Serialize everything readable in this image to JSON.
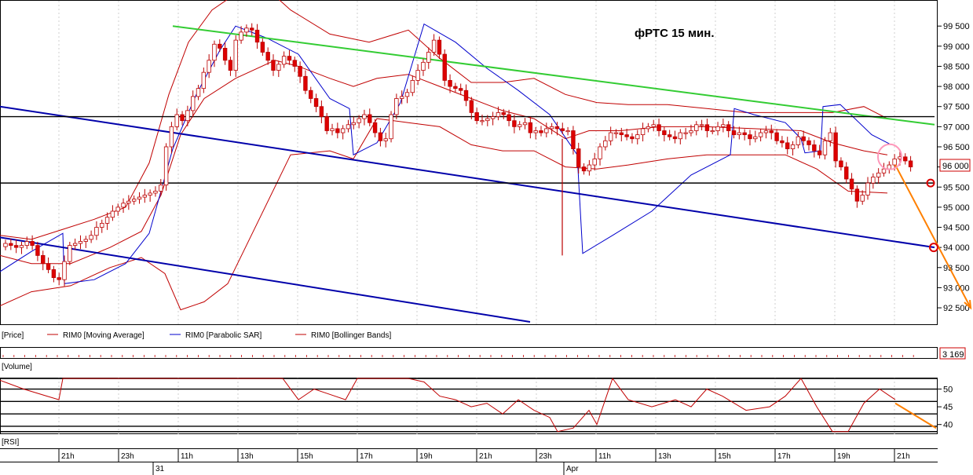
{
  "chart_data": {
    "type": "candlestick",
    "title": "фРТС   15 мин.",
    "price_axis": {
      "ticks": [
        "99 500",
        "99 000",
        "98 500",
        "98 000",
        "97 500",
        "97 000",
        "96 500",
        "96 000",
        "95 500",
        "95 000",
        "94 500",
        "94 000",
        "93 500",
        "93 000",
        "92 500"
      ],
      "range": [
        92150,
        100050
      ],
      "last_price_label": "96 000",
      "last_price": 96000
    },
    "time_axis": {
      "hour_labels": [
        "21h",
        "23h",
        "11h",
        "13h",
        "15h",
        "17h",
        "19h",
        "21h",
        "23h",
        "11h",
        "13h",
        "15h",
        "17h",
        "19h",
        "21h"
      ],
      "day_labels": [
        "31",
        "Apr"
      ]
    },
    "legend": [
      {
        "label": "[Price]",
        "color": "#000000"
      },
      {
        "label": "RIM0 [Moving Average]",
        "color": "#c00000"
      },
      {
        "label": "RIM0 [Parabolic SAR]",
        "color": "#0000cc"
      },
      {
        "label": "RIM0 [Bollinger Bands]",
        "color": "#c00000"
      }
    ],
    "volume_panel": {
      "label": "[Volume]",
      "last_value_label": "3 169"
    },
    "rsi_panel": {
      "label": "[RSI]",
      "ticks": [
        "50",
        "45",
        "40"
      ],
      "range": [
        37.5,
        53
      ],
      "levels": [
        53,
        50,
        46.5,
        43,
        39.5,
        38
      ]
    },
    "closes": [
      94100,
      94050,
      94000,
      94050,
      94150,
      94050,
      93800,
      93600,
      93450,
      93250,
      93200,
      93650,
      94050,
      94100,
      94150,
      94200,
      94300,
      94500,
      94600,
      94750,
      94900,
      95000,
      95100,
      95150,
      95200,
      95250,
      95300,
      95350,
      95400,
      95550,
      96500,
      97000,
      97300,
      97150,
      97400,
      97750,
      97950,
      98350,
      98650,
      99050,
      98950,
      98650,
      98400,
      99150,
      99350,
      99450,
      99400,
      99100,
      98850,
      98650,
      98400,
      98550,
      98750,
      98650,
      98500,
      98250,
      97900,
      97700,
      97500,
      97250,
      96900,
      96950,
      96850,
      96950,
      97050,
      97100,
      97200,
      97300,
      97100,
      96850,
      96650,
      96700,
      97300,
      97700,
      97750,
      97850,
      98150,
      98400,
      98600,
      98850,
      99150,
      98800,
      98150,
      98000,
      97950,
      97900,
      97650,
      97350,
      97150,
      97150,
      97200,
      97250,
      97350,
      97300,
      97150,
      97000,
      97050,
      97100,
      96850,
      96900,
      96850,
      96950,
      97000,
      96950,
      96900,
      96900,
      96450,
      96000,
      95900,
      96050,
      96200,
      96500,
      96650,
      96850,
      96850,
      96800,
      96750,
      96700,
      96800,
      96950,
      97000,
      97050,
      96900,
      96800,
      96750,
      96700,
      96850,
      96850,
      96900,
      97050,
      97050,
      96900,
      96900,
      97000,
      97050,
      96900,
      96800,
      96850,
      96800,
      96700,
      96750,
      96850,
      96900,
      96850,
      96650,
      96600,
      96450,
      96550,
      96750,
      96650,
      96550,
      96400,
      96300,
      96650,
      96850,
      96150,
      96000,
      95700,
      95450,
      95150,
      95300,
      95600,
      95750,
      95850,
      95950,
      96050,
      96200,
      96250,
      96150,
      96000
    ],
    "moving_average": [
      [
        0,
        93800
      ],
      [
        40,
        93600
      ],
      [
        90,
        93600
      ],
      [
        140,
        94000
      ],
      [
        180,
        94400
      ],
      [
        205,
        95300
      ],
      [
        230,
        96800
      ],
      [
        260,
        97700
      ],
      [
        300,
        98200
      ],
      [
        350,
        98650
      ],
      [
        380,
        98500
      ],
      [
        420,
        98200
      ],
      [
        450,
        98000
      ],
      [
        480,
        98200
      ],
      [
        520,
        98300
      ],
      [
        560,
        98000
      ],
      [
        600,
        97700
      ],
      [
        640,
        97400
      ],
      [
        680,
        97200
      ],
      [
        720,
        96700
      ],
      [
        750,
        96900
      ],
      [
        790,
        96900
      ],
      [
        840,
        97000
      ],
      [
        900,
        97000
      ],
      [
        960,
        96950
      ],
      [
        1020,
        96900
      ],
      [
        1060,
        96600
      ],
      [
        1100,
        96400
      ],
      [
        1130,
        96300
      ]
    ],
    "bollinger_upper": [
      [
        0,
        94300
      ],
      [
        40,
        94200
      ],
      [
        80,
        94450
      ],
      [
        120,
        94700
      ],
      [
        160,
        95000
      ],
      [
        190,
        96100
      ],
      [
        215,
        97800
      ],
      [
        240,
        99100
      ],
      [
        270,
        99900
      ],
      [
        300,
        100300
      ],
      [
        330,
        100600
      ],
      [
        370,
        99900
      ],
      [
        420,
        99300
      ],
      [
        470,
        99100
      ],
      [
        520,
        99400
      ],
      [
        560,
        98700
      ],
      [
        600,
        98100
      ],
      [
        640,
        98100
      ],
      [
        680,
        98200
      ],
      [
        720,
        97800
      ],
      [
        760,
        97600
      ],
      [
        800,
        97550
      ],
      [
        850,
        97550
      ],
      [
        900,
        97450
      ],
      [
        950,
        97350
      ],
      [
        1000,
        97350
      ],
      [
        1060,
        97350
      ],
      [
        1100,
        97500
      ],
      [
        1130,
        97200
      ]
    ],
    "bollinger_lower": [
      [
        0,
        92550
      ],
      [
        40,
        92900
      ],
      [
        90,
        93050
      ],
      [
        140,
        93500
      ],
      [
        180,
        93750
      ],
      [
        210,
        93350
      ],
      [
        230,
        92450
      ],
      [
        260,
        92650
      ],
      [
        290,
        93100
      ],
      [
        330,
        94700
      ],
      [
        370,
        96300
      ],
      [
        420,
        96400
      ],
      [
        450,
        96200
      ],
      [
        480,
        97200
      ],
      [
        520,
        97100
      ],
      [
        560,
        97000
      ],
      [
        600,
        96550
      ],
      [
        640,
        96400
      ],
      [
        680,
        96400
      ],
      [
        720,
        96000
      ],
      [
        760,
        95950
      ],
      [
        800,
        96050
      ],
      [
        850,
        96200
      ],
      [
        900,
        96300
      ],
      [
        950,
        96300
      ],
      [
        1000,
        96300
      ],
      [
        1040,
        95950
      ],
      [
        1080,
        95400
      ],
      [
        1130,
        95350
      ]
    ],
    "parabolic_sar": [
      [
        0,
        93400
      ],
      [
        40,
        93900
      ],
      [
        80,
        94350
      ],
      [
        82,
        93100
      ],
      [
        120,
        93200
      ],
      [
        160,
        93600
      ],
      [
        190,
        94350
      ],
      [
        220,
        96450
      ],
      [
        250,
        97800
      ],
      [
        280,
        98900
      ],
      [
        300,
        99500
      ],
      [
        340,
        99200
      ],
      [
        380,
        98800
      ],
      [
        420,
        97700
      ],
      [
        445,
        97450
      ],
      [
        450,
        96300
      ],
      [
        480,
        96600
      ],
      [
        510,
        97600
      ],
      [
        540,
        99550
      ],
      [
        580,
        99100
      ],
      [
        620,
        98450
      ],
      [
        660,
        97900
      ],
      [
        700,
        97300
      ],
      [
        735,
        96300
      ],
      [
        742,
        93850
      ],
      [
        780,
        94300
      ],
      [
        830,
        94900
      ],
      [
        880,
        95800
      ],
      [
        930,
        96300
      ],
      [
        935,
        97450
      ],
      [
        960,
        97300
      ],
      [
        1000,
        97100
      ],
      [
        1020,
        96700
      ],
      [
        1025,
        96350
      ],
      [
        1045,
        96400
      ],
      [
        1048,
        97500
      ],
      [
        1070,
        97550
      ],
      [
        1110,
        96800
      ],
      [
        1135,
        96550
      ]
    ],
    "trendlines": [
      {
        "color": "#33cc33",
        "points": [
          [
            220,
            99500
          ],
          [
            1190,
            97050
          ]
        ]
      },
      {
        "color": "#0000aa",
        "points": [
          [
            0,
            97500
          ],
          [
            1190,
            94000
          ]
        ]
      },
      {
        "color": "#0000aa",
        "points": [
          [
            0,
            94250
          ],
          [
            675,
            92150
          ]
        ]
      },
      {
        "color": "#000000",
        "points": [
          [
            0,
            97250
          ],
          [
            1190,
            97250
          ]
        ]
      },
      {
        "color": "#000000",
        "points": [
          [
            0,
            95600
          ],
          [
            1190,
            95600
          ]
        ]
      },
      {
        "color": "#ff8000",
        "points": [
          [
            1140,
            96050
          ],
          [
            1236,
            92500
          ]
        ]
      }
    ],
    "rsi_values": [
      [
        0,
        52.5
      ],
      [
        30,
        50
      ],
      [
        60,
        48
      ],
      [
        75,
        47
      ],
      [
        80,
        53
      ],
      [
        90,
        53
      ],
      [
        360,
        53
      ],
      [
        380,
        47
      ],
      [
        400,
        50
      ],
      [
        420,
        48.5
      ],
      [
        440,
        47
      ],
      [
        455,
        53
      ],
      [
        520,
        53
      ],
      [
        540,
        52
      ],
      [
        560,
        48
      ],
      [
        580,
        47
      ],
      [
        600,
        45
      ],
      [
        620,
        46
      ],
      [
        640,
        43
      ],
      [
        660,
        47
      ],
      [
        680,
        44
      ],
      [
        700,
        42
      ],
      [
        710,
        38
      ],
      [
        730,
        39
      ],
      [
        750,
        44
      ],
      [
        760,
        40
      ],
      [
        780,
        53
      ],
      [
        800,
        47
      ],
      [
        830,
        45
      ],
      [
        860,
        47
      ],
      [
        880,
        45
      ],
      [
        900,
        50
      ],
      [
        920,
        48
      ],
      [
        950,
        44
      ],
      [
        980,
        45
      ],
      [
        1000,
        48
      ],
      [
        1020,
        53
      ],
      [
        1040,
        45
      ],
      [
        1060,
        38
      ],
      [
        1080,
        38
      ],
      [
        1100,
        46
      ],
      [
        1120,
        50
      ],
      [
        1140,
        47
      ]
    ],
    "rsi_arrow": [
      [
        1140,
        46
      ],
      [
        1192,
        39
      ]
    ]
  }
}
